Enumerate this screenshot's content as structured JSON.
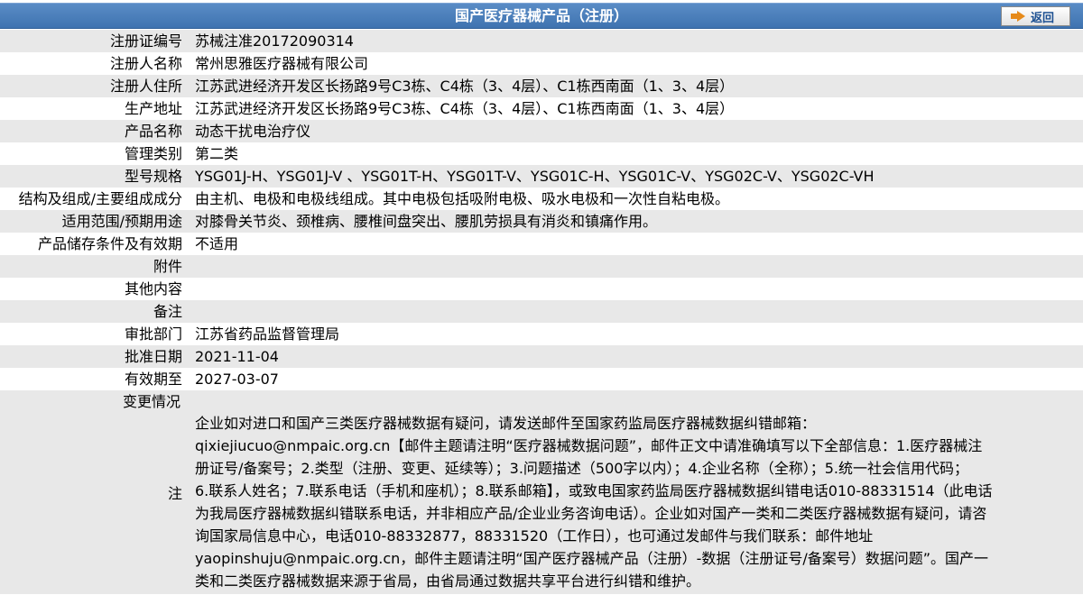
{
  "header": {
    "title": "国产医疗器械产品（注册）",
    "back_label": "返回"
  },
  "fields": [
    {
      "label": "注册证编号",
      "value": "苏械注准20172090314"
    },
    {
      "label": "注册人名称",
      "value": "常州思雅医疗器械有限公司"
    },
    {
      "label": "注册人住所",
      "value": "江苏武进经济开发区长扬路9号C3栋、C4栋（3、4层）、C1栋西南面（1、3、4层）"
    },
    {
      "label": "生产地址",
      "value": "江苏武进经济开发区长扬路9号C3栋、C4栋（3、4层）、C1栋西南面（1、3、4层）"
    },
    {
      "label": "产品名称",
      "value": "动态干扰电治疗仪"
    },
    {
      "label": "管理类别",
      "value": "第二类"
    },
    {
      "label": "型号规格",
      "value": "YSG01J-H、YSG01J-V 、YSG01T-H、YSG01T-V、YSG01C-H、YSG01C-V、YSG02C-V、YSG02C-VH"
    },
    {
      "label": "结构及组成/主要组成成分",
      "value": "由主机、电极和电极线组成。其中电极包括吸附电极、吸水电极和一次性自粘电极。"
    },
    {
      "label": "适用范围/预期用途",
      "value": "对膝骨关节炎、颈椎病、腰椎间盘突出、腰肌劳损具有消炎和镇痛作用。"
    },
    {
      "label": "产品储存条件及有效期",
      "value": "不适用"
    },
    {
      "label": "附件",
      "value": ""
    },
    {
      "label": "其他内容",
      "value": ""
    },
    {
      "label": "备注",
      "value": ""
    },
    {
      "label": "审批部门",
      "value": "江苏省药品监督管理局"
    },
    {
      "label": "批准日期",
      "value": "2021-11-04"
    },
    {
      "label": "有效期至",
      "value": "2027-03-07"
    },
    {
      "label": "变更情况",
      "value": ""
    }
  ],
  "note": {
    "label": "注",
    "lines": [
      "企业如对进口和国产三类医疗器械数据有疑问，请发送邮件至国家药监局医疗器械数据纠错邮箱：",
      "qixiejiucuo@nmpaic.org.cn【邮件主题请注明“医疗器械数据问题”，邮件正文中请准确填写以下全部信息：1.医疗器械注",
      "册证号/备案号；2.类型（注册、变更、延续等）；3.问题描述（500字以内）；4.企业名称（全称）；5.统一社会信用代码；",
      "6.联系人姓名；7.联系电话（手机和座机）；8.联系邮箱】，或致电国家药监局医疗器械数据纠错电话010-88331514（此电话",
      "为我局医疗器械数据纠错联系电话，并非相应产品/企业业务咨询电话）。企业如对国产一类和二类医疗器械数据有疑问，请咨",
      "询国家局信息中心，电话010-88332877，88331520（工作日），也可通过发邮件与我们联系：邮件地址",
      "yaopinshuju@nmpaic.org.cn，邮件主题请注明“国产医疗器械产品（注册）-数据（注册证号/备案号）数据问题”。国产一",
      "类和二类医疗器械数据来源于省局，由省局通过数据共享平台进行纠错和维护。"
    ]
  }
}
